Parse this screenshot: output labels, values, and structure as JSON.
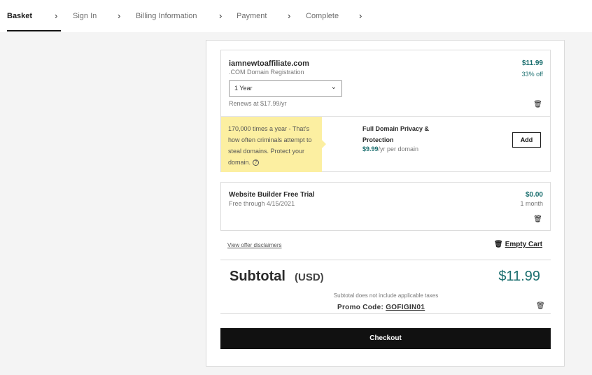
{
  "nav": {
    "steps": [
      "Basket",
      "Sign In",
      "Billing Information",
      "Payment",
      "Complete"
    ],
    "chevron": "›"
  },
  "domain": {
    "name": "iamnewtoaffiliate.com",
    "type": ".COM Domain Registration",
    "price": "$11.99",
    "discount": "33% off",
    "term_selected": "1 Year",
    "renewal": "Renews at $17.99/yr"
  },
  "privacy_upsell": {
    "tip_text": "170,000 times a year - That's how often criminals attempt to steal domains. Protect your domain.",
    "name": "Full Domain Privacy & Protection",
    "price": "$9.99",
    "price_suffix": "/yr per domain",
    "add_label": "Add"
  },
  "website_builder": {
    "name": "Website Builder Free Trial",
    "free_through": "Free through 4/15/2021",
    "price": "$0.00",
    "term": "1 month"
  },
  "links": {
    "disclaimers": "View offer disclaimers",
    "empty_cart": "Empty Cart"
  },
  "summary": {
    "subtotal_label": "Subtotal",
    "currency_label": "(USD)",
    "subtotal_value": "$11.99",
    "tax_note": "Subtotal does not include applicable taxes",
    "promo_label": "Promo Code:",
    "promo_code": "GOFIGIN01"
  },
  "checkout_label": "Checkout",
  "colors": {
    "accent_teal": "#1b6f6f",
    "tip_yellow": "#fcefa1",
    "checkout_black": "#111111"
  },
  "icons": [
    "chevron-right-icon",
    "chevron-down-icon",
    "trash-icon",
    "help-icon"
  ]
}
